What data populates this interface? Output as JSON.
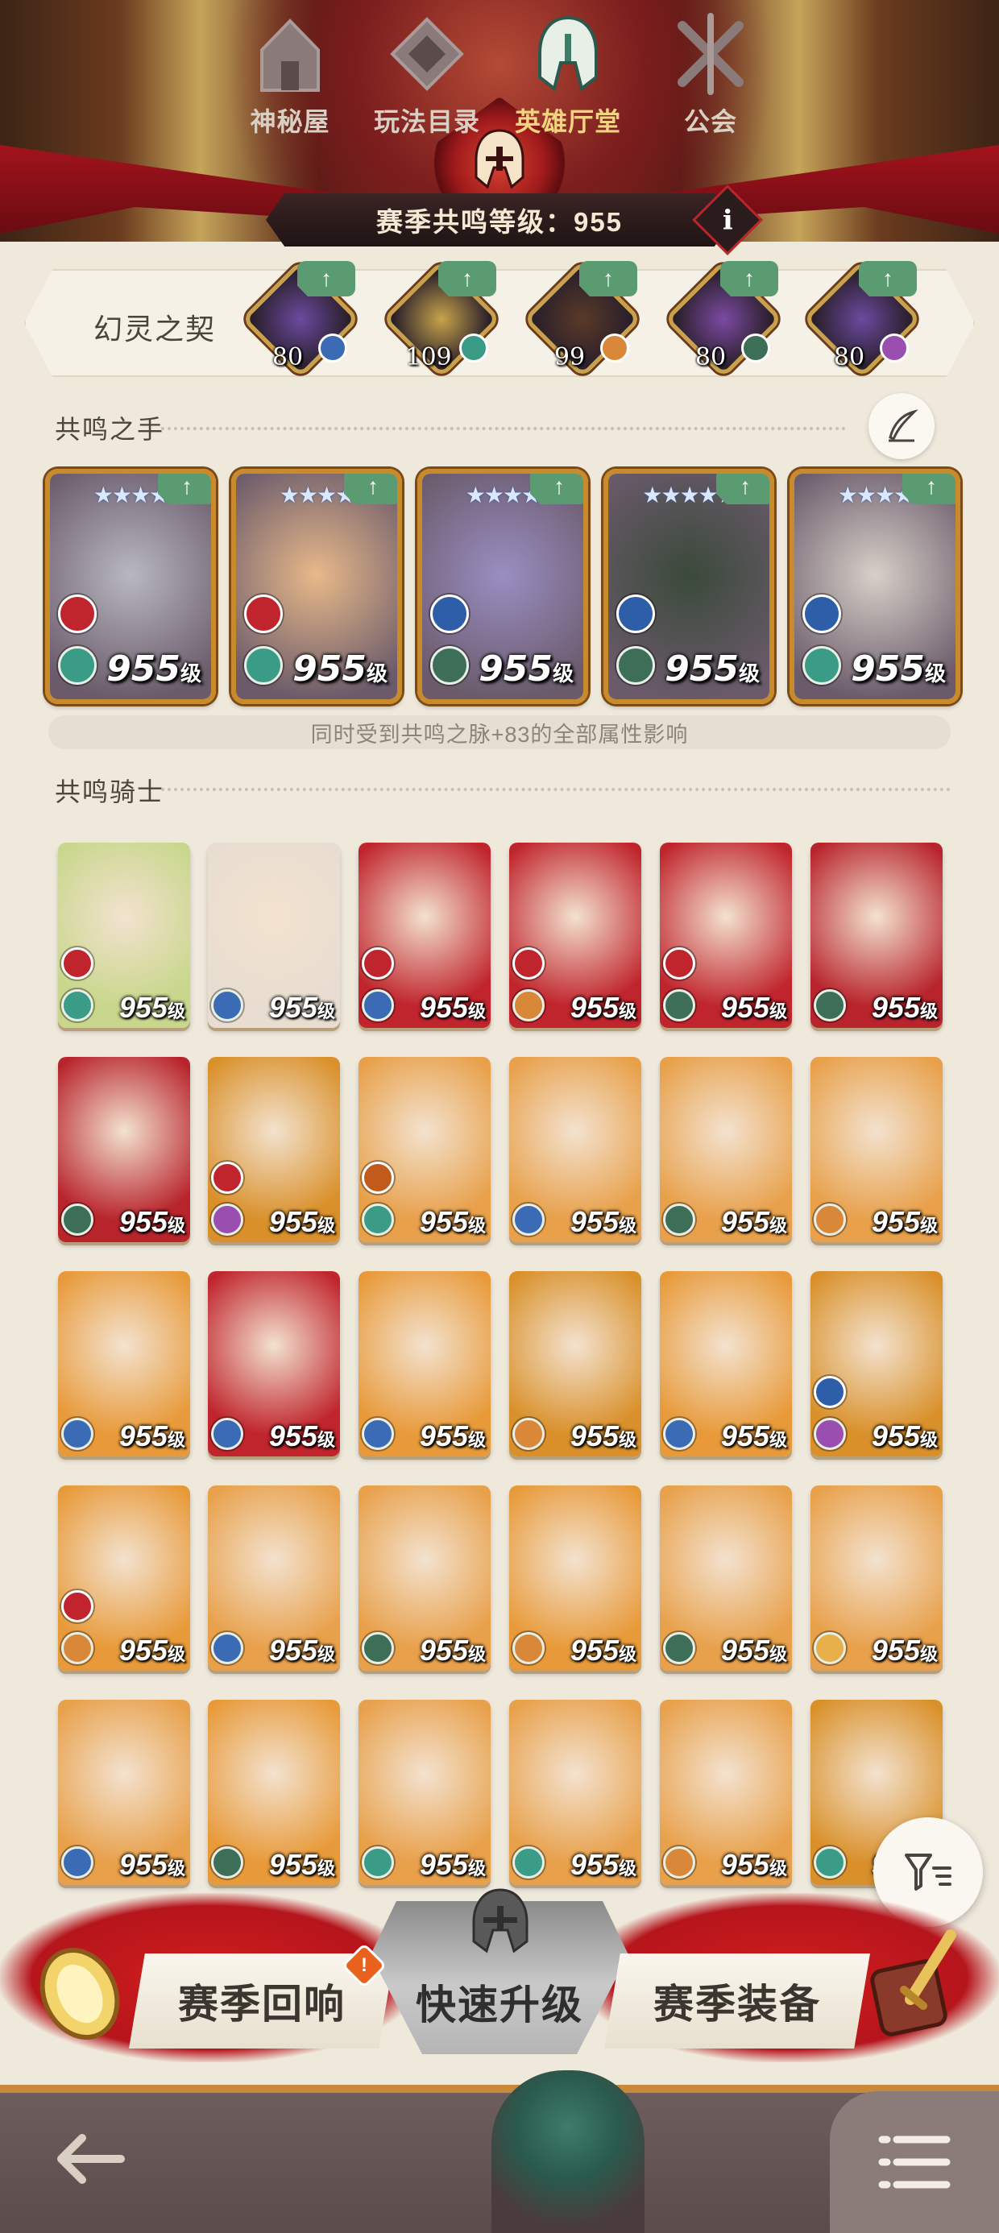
{
  "header": {
    "season_level_label": "赛季共鸣等级：955",
    "info_symbol": "i"
  },
  "pact": {
    "label": "幻灵之契",
    "items": [
      {
        "level": "80",
        "color": "#6b4aa0",
        "badge": "#3b6bb5"
      },
      {
        "level": "109",
        "color": "#c7a44c",
        "badge": "#3a9c86"
      },
      {
        "level": "99",
        "color": "#5a3a28",
        "badge": "#d9883a"
      },
      {
        "level": "80",
        "color": "#7c4aa3",
        "badge": "#3d6f58"
      },
      {
        "level": "80",
        "color": "#6b4aa0",
        "badge": "#9a4fb0"
      }
    ]
  },
  "hand": {
    "title": "共鸣之手",
    "cards": [
      {
        "stars": "★★★★",
        "level": "955",
        "suffix": "级",
        "bg": "#b8b8c0",
        "faction": "#c0242c",
        "klass": "#3a9c86"
      },
      {
        "stars": "★★★★",
        "level": "955",
        "suffix": "级",
        "bg": "#e8b98a",
        "faction": "#c0242c",
        "klass": "#3a9c86"
      },
      {
        "stars": "★★★★",
        "level": "955",
        "suffix": "级",
        "bg": "#9a8ec2",
        "faction": "#2f5ea8",
        "klass": "#3d6f58"
      },
      {
        "stars": "★★★★★",
        "level": "955",
        "suffix": "级",
        "bg": "#3a4a3a",
        "faction": "#2f5ea8",
        "klass": "#3d6f58"
      },
      {
        "stars": "★★★★",
        "level": "955",
        "suffix": "级",
        "bg": "#d7d0c8",
        "faction": "#2f5ea8",
        "klass": "#3a9c86"
      }
    ],
    "note": "同时受到共鸣之脉+83的全部属性影响"
  },
  "knights": {
    "title": "共鸣骑士",
    "cards": [
      {
        "level": "955",
        "suffix": "级",
        "bg": "#c8d78c",
        "faction": "#c0242c",
        "klass": "#3a9c86"
      },
      {
        "level": "955",
        "suffix": "级",
        "bg": "#e8ddd0",
        "faction": "",
        "klass": "#3b6bb5"
      },
      {
        "level": "955",
        "suffix": "级",
        "bg": "#c0242c",
        "faction": "#c0242c",
        "klass": "#3b6bb5"
      },
      {
        "level": "955",
        "suffix": "级",
        "bg": "#c0242c",
        "faction": "#c0242c",
        "klass": "#d9883a"
      },
      {
        "level": "955",
        "suffix": "级",
        "bg": "#c0242c",
        "faction": "#c0242c",
        "klass": "#3d6f58"
      },
      {
        "level": "955",
        "suffix": "级",
        "bg": "#b8242c",
        "faction": "",
        "klass": "#3d6f58"
      },
      {
        "level": "955",
        "suffix": "级",
        "bg": "#b8242c",
        "faction": "",
        "klass": "#3d6f58"
      },
      {
        "level": "955",
        "suffix": "级",
        "bg": "#d9902a",
        "faction": "#c0242c",
        "klass": "#9a4fb0"
      },
      {
        "level": "955",
        "suffix": "级",
        "bg": "#e8a04a",
        "faction": "#c25a1c",
        "klass": "#3a9c86"
      },
      {
        "level": "955",
        "suffix": "级",
        "bg": "#e8a04a",
        "faction": "",
        "klass": "#3b6bb5"
      },
      {
        "level": "955",
        "suffix": "级",
        "bg": "#e8a04a",
        "faction": "",
        "klass": "#3d6f58"
      },
      {
        "level": "955",
        "suffix": "级",
        "bg": "#e8a04a",
        "faction": "",
        "klass": "#d9883a"
      },
      {
        "level": "955",
        "suffix": "级",
        "bg": "#e89a3a",
        "faction": "",
        "klass": "#3b6bb5"
      },
      {
        "level": "955",
        "suffix": "级",
        "bg": "#c0242c",
        "faction": "",
        "klass": "#3b6bb5"
      },
      {
        "level": "955",
        "suffix": "级",
        "bg": "#e89a3a",
        "faction": "",
        "klass": "#3b6bb5"
      },
      {
        "level": "955",
        "suffix": "级",
        "bg": "#d9902a",
        "faction": "",
        "klass": "#d9883a"
      },
      {
        "level": "955",
        "suffix": "级",
        "bg": "#e89a3a",
        "faction": "",
        "klass": "#3b6bb5"
      },
      {
        "level": "955",
        "suffix": "级",
        "bg": "#d9902a",
        "faction": "#2f5ea8",
        "klass": "#9a4fb0"
      },
      {
        "level": "955",
        "suffix": "级",
        "bg": "#e89a3a",
        "faction": "#c0242c",
        "klass": "#d9883a"
      },
      {
        "level": "955",
        "suffix": "级",
        "bg": "#e8a04a",
        "faction": "",
        "klass": "#3b6bb5"
      },
      {
        "level": "955",
        "suffix": "级",
        "bg": "#e8a04a",
        "faction": "",
        "klass": "#3d6f58"
      },
      {
        "level": "955",
        "suffix": "级",
        "bg": "#e89a3a",
        "faction": "",
        "klass": "#d9883a"
      },
      {
        "level": "955",
        "suffix": "级",
        "bg": "#e8a04a",
        "faction": "",
        "klass": "#3d6f58"
      },
      {
        "level": "955",
        "suffix": "级",
        "bg": "#e8a04a",
        "faction": "",
        "klass": "#e8b04a"
      },
      {
        "level": "955",
        "suffix": "级",
        "bg": "#e8a04a",
        "faction": "",
        "klass": "#3b6bb5"
      },
      {
        "level": "955",
        "suffix": "级",
        "bg": "#e89a3a",
        "faction": "",
        "klass": "#3d6f58"
      },
      {
        "level": "955",
        "suffix": "级",
        "bg": "#e8a04a",
        "faction": "",
        "klass": "#3a9c86"
      },
      {
        "level": "955",
        "suffix": "级",
        "bg": "#e8a04a",
        "faction": "",
        "klass": "#3a9c86"
      },
      {
        "level": "955",
        "suffix": "级",
        "bg": "#e8a04a",
        "faction": "",
        "klass": "#d9883a"
      },
      {
        "level": "955",
        "suffix": "级",
        "bg": "#d9902a",
        "faction": "",
        "klass": "#3a9c86"
      }
    ]
  },
  "actions": {
    "left": "赛季回响",
    "center": "快速升级",
    "right": "赛季装备",
    "notify": "!"
  },
  "nav": {
    "items": [
      {
        "label": "神秘屋"
      },
      {
        "label": "玩法目录"
      },
      {
        "label": "英雄厅堂"
      },
      {
        "label": "公会"
      }
    ]
  },
  "colors": {
    "accent_red": "#b5151c",
    "nav_active": "#f1d480",
    "upgrade_green": "#5b9b72"
  }
}
